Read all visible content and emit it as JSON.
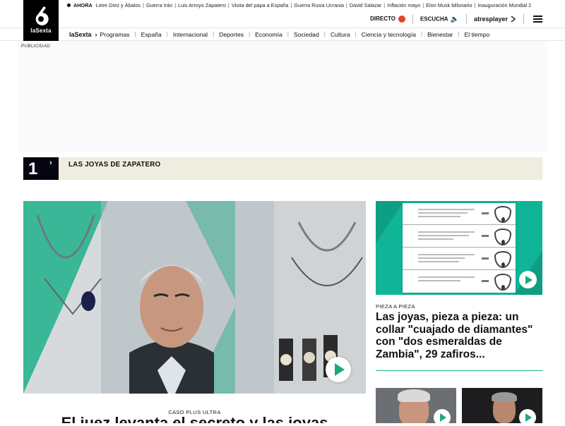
{
  "brand": {
    "logo_text": "laSexta",
    "nav_brand": "laSexta"
  },
  "ticker": {
    "label": "AHORA",
    "items": [
      "Leire Díez y Ábalos",
      "Guerra Irán",
      "Luis Arroyo Zapatero",
      "Visita del papa a España",
      "Guerra Rusia Ucrania",
      "David Salazar",
      "Inflación mayo",
      "Elon Musk billonario",
      "Inauguración Mundial 2"
    ]
  },
  "topbar": {
    "directo": "DIRECTO",
    "escucha": "ESCUCHA",
    "atresplayer": "atresplayer"
  },
  "nav": {
    "items": [
      "Programas",
      "España",
      "Internacional",
      "Deportes",
      "Economía",
      "Sociedad",
      "Cultura",
      "Ciencia y tecnología",
      "Bienestar",
      "El tiempo"
    ]
  },
  "ad": {
    "label": "PUBLICIDAD"
  },
  "topic": {
    "number": "1",
    "title": "LAS JOYAS DE ZAPATERO"
  },
  "main_story": {
    "kicker": "CASO PLUS ULTRA",
    "headline": "El juez levanta el secreto y las joyas"
  },
  "side_story": {
    "kicker": "PIEZA A PIEZA",
    "headline": "Las joyas, pieza a pieza: un collar \"cuajado de diamantes\" con \"dos esmeraldas de Zambia\", 29 zafiros..."
  },
  "colors": {
    "accent_green": "#1ea97c",
    "live_red": "#e4432b",
    "topic_bg": "#efece0",
    "teal": "#10b597"
  },
  "icons": {
    "play": "play-icon",
    "menu": "hamburger-menu-icon",
    "speaker": "speaker-icon",
    "live": "live-dot-icon"
  }
}
